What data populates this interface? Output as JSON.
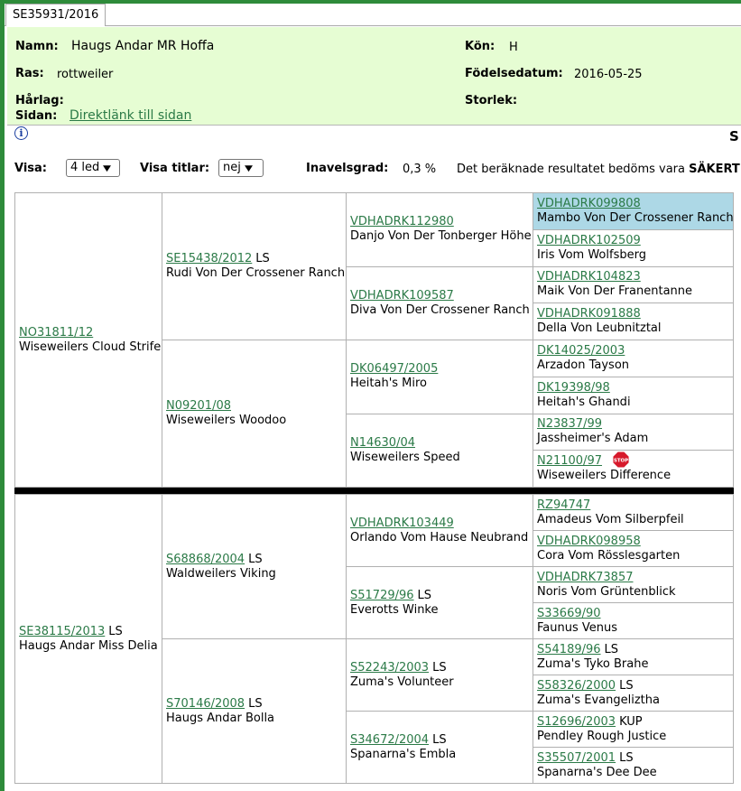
{
  "tab": {
    "label": "SE35931/2016"
  },
  "info": {
    "namn_label": "Namn:",
    "namn_value": "Haugs Andar MR Hoffa",
    "kon_label": "Kön:",
    "kon_value": "H",
    "ras_label": "Ras:",
    "ras_value": "rottweiler",
    "fodelse_label": "Födelsedatum:",
    "fodelse_value": "2016-05-25",
    "harlag_label": "Hårlag:",
    "storlek_label": "Storlek:",
    "sidan_label": "Sidan:",
    "sidan_link": "Direktlänk till sidan"
  },
  "header_cut_text": "S",
  "controls": {
    "visa_label": "Visa:",
    "visa_value": "4 led",
    "titlar_label": "Visa titlar:",
    "titlar_value": "nej",
    "inavel_label": "Inavelsgrad:",
    "inavel_value": "0,3 %",
    "result_text": "Det beräknade resultatet bedöms vara",
    "result_bold": "SÄKERT",
    "result_end": "."
  },
  "pedigree": {
    "sire": {
      "reg": "NO31811/12",
      "ls": "",
      "name": "Wiseweilers Cloud Strife"
    },
    "dam": {
      "reg": "SE38115/2013",
      "ls": "LS",
      "name": "Haugs Andar Miss Delia"
    },
    "gen2": [
      {
        "reg": "SE15438/2012",
        "ls": "LS",
        "name": "Rudi Von Der Crossener Ranch"
      },
      {
        "reg": "N09201/08",
        "ls": "",
        "name": "Wiseweilers Woodoo"
      },
      {
        "reg": "S68868/2004",
        "ls": "LS",
        "name": "Waldweilers Viking"
      },
      {
        "reg": "S70146/2008",
        "ls": "LS",
        "name": "Haugs Andar Bolla"
      }
    ],
    "gen3": [
      {
        "reg": "VDHADRK112980",
        "ls": "",
        "name": "Danjo Von Der Tonberger Höhe"
      },
      {
        "reg": "VDHADRK109587",
        "ls": "",
        "name": "Diva Von Der Crossener Ranch"
      },
      {
        "reg": "DK06497/2005",
        "ls": "",
        "name": "Heitah's Miro"
      },
      {
        "reg": "N14630/04",
        "ls": "",
        "name": "Wiseweilers Speed"
      },
      {
        "reg": "VDHADRK103449",
        "ls": "",
        "name": "Orlando Vom Hause Neubrand"
      },
      {
        "reg": "S51729/96",
        "ls": "LS",
        "name": "Everotts Winke"
      },
      {
        "reg": "S52243/2003",
        "ls": "LS",
        "name": "Zuma's Volunteer"
      },
      {
        "reg": "S34672/2004",
        "ls": "LS",
        "name": "Spanarna's Embla"
      }
    ],
    "gen4": [
      {
        "reg": "VDHADRK099808",
        "ls": "",
        "name": "Mambo Von Der Crossener Ranch"
      },
      {
        "reg": "VDHADRK102509",
        "ls": "",
        "name": "Iris Vom Wolfsberg"
      },
      {
        "reg": "VDHADRK104823",
        "ls": "",
        "name": "Maik Von Der Franentanne"
      },
      {
        "reg": "VDHADRK091888",
        "ls": "",
        "name": "Della Von Leubnitztal"
      },
      {
        "reg": "DK14025/2003",
        "ls": "",
        "name": "Arzadon Tayson"
      },
      {
        "reg": "DK19398/98",
        "ls": "",
        "name": "Heitah's Ghandi"
      },
      {
        "reg": "N23837/99",
        "ls": "",
        "name": "Jassheimer's Adam"
      },
      {
        "reg": "N21100/97",
        "ls": "",
        "name": "Wiseweilers Difference",
        "stop": "STOP"
      },
      {
        "reg": "RZ94747",
        "ls": "",
        "name": "Amadeus Vom Silberpfeil"
      },
      {
        "reg": "VDHADRK098958",
        "ls": "",
        "name": "Cora Vom Rösslesgarten"
      },
      {
        "reg": "VDHADRK73857",
        "ls": "",
        "name": "Noris Vom Grüntenblick"
      },
      {
        "reg": "S33669/90",
        "ls": "",
        "name": "Faunus Venus"
      },
      {
        "reg": "S54189/96",
        "ls": "LS",
        "name": "Zuma's Tyko Brahe"
      },
      {
        "reg": "S58326/2000",
        "ls": "LS",
        "name": "Zuma's Evangeliztha"
      },
      {
        "reg": "S12696/2003",
        "ls": "KUP",
        "name": "Pendley Rough Justice"
      },
      {
        "reg": "S35507/2001",
        "ls": "LS",
        "name": "Spanarna's Dee Dee"
      }
    ]
  },
  "colors": {
    "accent_green": "#2e8b3a",
    "panel_bg": "#e6fdd3",
    "link": "#2b7a47",
    "highlight": "#add8e6",
    "stop_red": "#d7192b"
  },
  "icons": {
    "info": "info-icon",
    "stop": "stop-sign-icon"
  }
}
